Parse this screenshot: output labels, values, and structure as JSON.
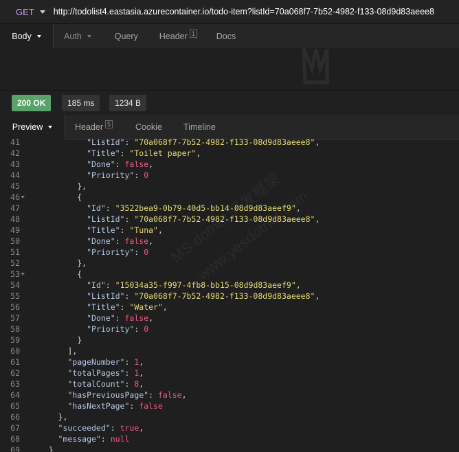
{
  "request": {
    "method": "GET",
    "url": "http://todolist4.eastasia.azurecontainer.io/todo-item?listId=70a068f7-7b52-4982-f133-08d9d83aeee8",
    "tabs": [
      {
        "label": "Body"
      },
      {
        "label": "Auth"
      },
      {
        "label": "Query"
      },
      {
        "label": "Header",
        "badge": "1"
      },
      {
        "label": "Docs"
      }
    ]
  },
  "response": {
    "status": "200 OK",
    "time": "185 ms",
    "size": "1234 B",
    "tabs": [
      {
        "label": "Preview"
      },
      {
        "label": "Header",
        "badge": "5"
      },
      {
        "label": "Cookie"
      },
      {
        "label": "Timeline"
      }
    ]
  },
  "code_lines": [
    {
      "n": "41",
      "fold": false,
      "indent": 12,
      "tokens": [
        [
          "k",
          "\"ListId\""
        ],
        [
          "p",
          ": "
        ],
        [
          "s",
          "\"70a068f7-7b52-4982-f133-08d9d83aeee8\""
        ],
        [
          "p",
          ","
        ]
      ]
    },
    {
      "n": "42",
      "fold": false,
      "indent": 12,
      "tokens": [
        [
          "k",
          "\"Title\""
        ],
        [
          "p",
          ": "
        ],
        [
          "s",
          "\"Toilet paper\""
        ],
        [
          "p",
          ","
        ]
      ]
    },
    {
      "n": "43",
      "fold": false,
      "indent": 12,
      "tokens": [
        [
          "k",
          "\"Done\""
        ],
        [
          "p",
          ": "
        ],
        [
          "f",
          "false"
        ],
        [
          "p",
          ","
        ]
      ]
    },
    {
      "n": "44",
      "fold": false,
      "indent": 12,
      "tokens": [
        [
          "k",
          "\"Priority\""
        ],
        [
          "p",
          ": "
        ],
        [
          "n",
          "0"
        ]
      ]
    },
    {
      "n": "45",
      "fold": false,
      "indent": 10,
      "tokens": [
        [
          "p",
          "},"
        ]
      ]
    },
    {
      "n": "46",
      "fold": true,
      "indent": 10,
      "tokens": [
        [
          "p",
          "{"
        ]
      ]
    },
    {
      "n": "47",
      "fold": false,
      "indent": 12,
      "tokens": [
        [
          "k",
          "\"Id\""
        ],
        [
          "p",
          ": "
        ],
        [
          "s",
          "\"3522bea9-0b79-40d5-bb14-08d9d83aeef9\""
        ],
        [
          "p",
          ","
        ]
      ]
    },
    {
      "n": "48",
      "fold": false,
      "indent": 12,
      "tokens": [
        [
          "k",
          "\"ListId\""
        ],
        [
          "p",
          ": "
        ],
        [
          "s",
          "\"70a068f7-7b52-4982-f133-08d9d83aeee8\""
        ],
        [
          "p",
          ","
        ]
      ]
    },
    {
      "n": "49",
      "fold": false,
      "indent": 12,
      "tokens": [
        [
          "k",
          "\"Title\""
        ],
        [
          "p",
          ": "
        ],
        [
          "s",
          "\"Tuna\""
        ],
        [
          "p",
          ","
        ]
      ]
    },
    {
      "n": "50",
      "fold": false,
      "indent": 12,
      "tokens": [
        [
          "k",
          "\"Done\""
        ],
        [
          "p",
          ": "
        ],
        [
          "f",
          "false"
        ],
        [
          "p",
          ","
        ]
      ]
    },
    {
      "n": "51",
      "fold": false,
      "indent": 12,
      "tokens": [
        [
          "k",
          "\"Priority\""
        ],
        [
          "p",
          ": "
        ],
        [
          "n",
          "0"
        ]
      ]
    },
    {
      "n": "52",
      "fold": false,
      "indent": 10,
      "tokens": [
        [
          "p",
          "},"
        ]
      ]
    },
    {
      "n": "53",
      "fold": true,
      "indent": 10,
      "tokens": [
        [
          "p",
          "{"
        ]
      ]
    },
    {
      "n": "54",
      "fold": false,
      "indent": 12,
      "tokens": [
        [
          "k",
          "\"Id\""
        ],
        [
          "p",
          ": "
        ],
        [
          "s",
          "\"15034a35-f997-4fb8-bb15-08d9d83aeef9\""
        ],
        [
          "p",
          ","
        ]
      ]
    },
    {
      "n": "55",
      "fold": false,
      "indent": 12,
      "tokens": [
        [
          "k",
          "\"ListId\""
        ],
        [
          "p",
          ": "
        ],
        [
          "s",
          "\"70a068f7-7b52-4982-f133-08d9d83aeee8\""
        ],
        [
          "p",
          ","
        ]
      ]
    },
    {
      "n": "56",
      "fold": false,
      "indent": 12,
      "tokens": [
        [
          "k",
          "\"Title\""
        ],
        [
          "p",
          ": "
        ],
        [
          "s",
          "\"Water\""
        ],
        [
          "p",
          ","
        ]
      ]
    },
    {
      "n": "57",
      "fold": false,
      "indent": 12,
      "tokens": [
        [
          "k",
          "\"Done\""
        ],
        [
          "p",
          ": "
        ],
        [
          "f",
          "false"
        ],
        [
          "p",
          ","
        ]
      ]
    },
    {
      "n": "58",
      "fold": false,
      "indent": 12,
      "tokens": [
        [
          "k",
          "\"Priority\""
        ],
        [
          "p",
          ": "
        ],
        [
          "n",
          "0"
        ]
      ]
    },
    {
      "n": "59",
      "fold": false,
      "indent": 10,
      "tokens": [
        [
          "p",
          "}"
        ]
      ]
    },
    {
      "n": "60",
      "fold": false,
      "indent": 8,
      "tokens": [
        [
          "p",
          "],"
        ]
      ]
    },
    {
      "n": "61",
      "fold": false,
      "indent": 8,
      "tokens": [
        [
          "k",
          "\"pageNumber\""
        ],
        [
          "p",
          ": "
        ],
        [
          "n",
          "1"
        ],
        [
          "p",
          ","
        ]
      ]
    },
    {
      "n": "62",
      "fold": false,
      "indent": 8,
      "tokens": [
        [
          "k",
          "\"totalPages\""
        ],
        [
          "p",
          ": "
        ],
        [
          "n",
          "1"
        ],
        [
          "p",
          ","
        ]
      ]
    },
    {
      "n": "63",
      "fold": false,
      "indent": 8,
      "tokens": [
        [
          "k",
          "\"totalCount\""
        ],
        [
          "p",
          ": "
        ],
        [
          "n",
          "8"
        ],
        [
          "p",
          ","
        ]
      ]
    },
    {
      "n": "64",
      "fold": false,
      "indent": 8,
      "tokens": [
        [
          "k",
          "\"hasPreviousPage\""
        ],
        [
          "p",
          ": "
        ],
        [
          "f",
          "false"
        ],
        [
          "p",
          ","
        ]
      ]
    },
    {
      "n": "65",
      "fold": false,
      "indent": 8,
      "tokens": [
        [
          "k",
          "\"hasNextPage\""
        ],
        [
          "p",
          ": "
        ],
        [
          "f",
          "false"
        ]
      ]
    },
    {
      "n": "66",
      "fold": false,
      "indent": 6,
      "tokens": [
        [
          "p",
          "},"
        ]
      ]
    },
    {
      "n": "67",
      "fold": false,
      "indent": 6,
      "tokens": [
        [
          "k",
          "\"succeeded\""
        ],
        [
          "p",
          ": "
        ],
        [
          "f",
          "true"
        ],
        [
          "p",
          ","
        ]
      ]
    },
    {
      "n": "68",
      "fold": false,
      "indent": 6,
      "tokens": [
        [
          "k",
          "\"message\""
        ],
        [
          "p",
          ": "
        ],
        [
          "f",
          "null"
        ]
      ]
    },
    {
      "n": "69",
      "fold": false,
      "indent": 4,
      "tokens": [
        [
          "p",
          "}"
        ]
      ]
    }
  ],
  "watermark": [
    "MS dotnet 开发框架",
    "www.yesdotnet.com"
  ],
  "colors": {
    "status_ok": "#59a36a",
    "method": "#c3a3f6",
    "string": "#e6db74",
    "literal": "#ef5b7f"
  }
}
